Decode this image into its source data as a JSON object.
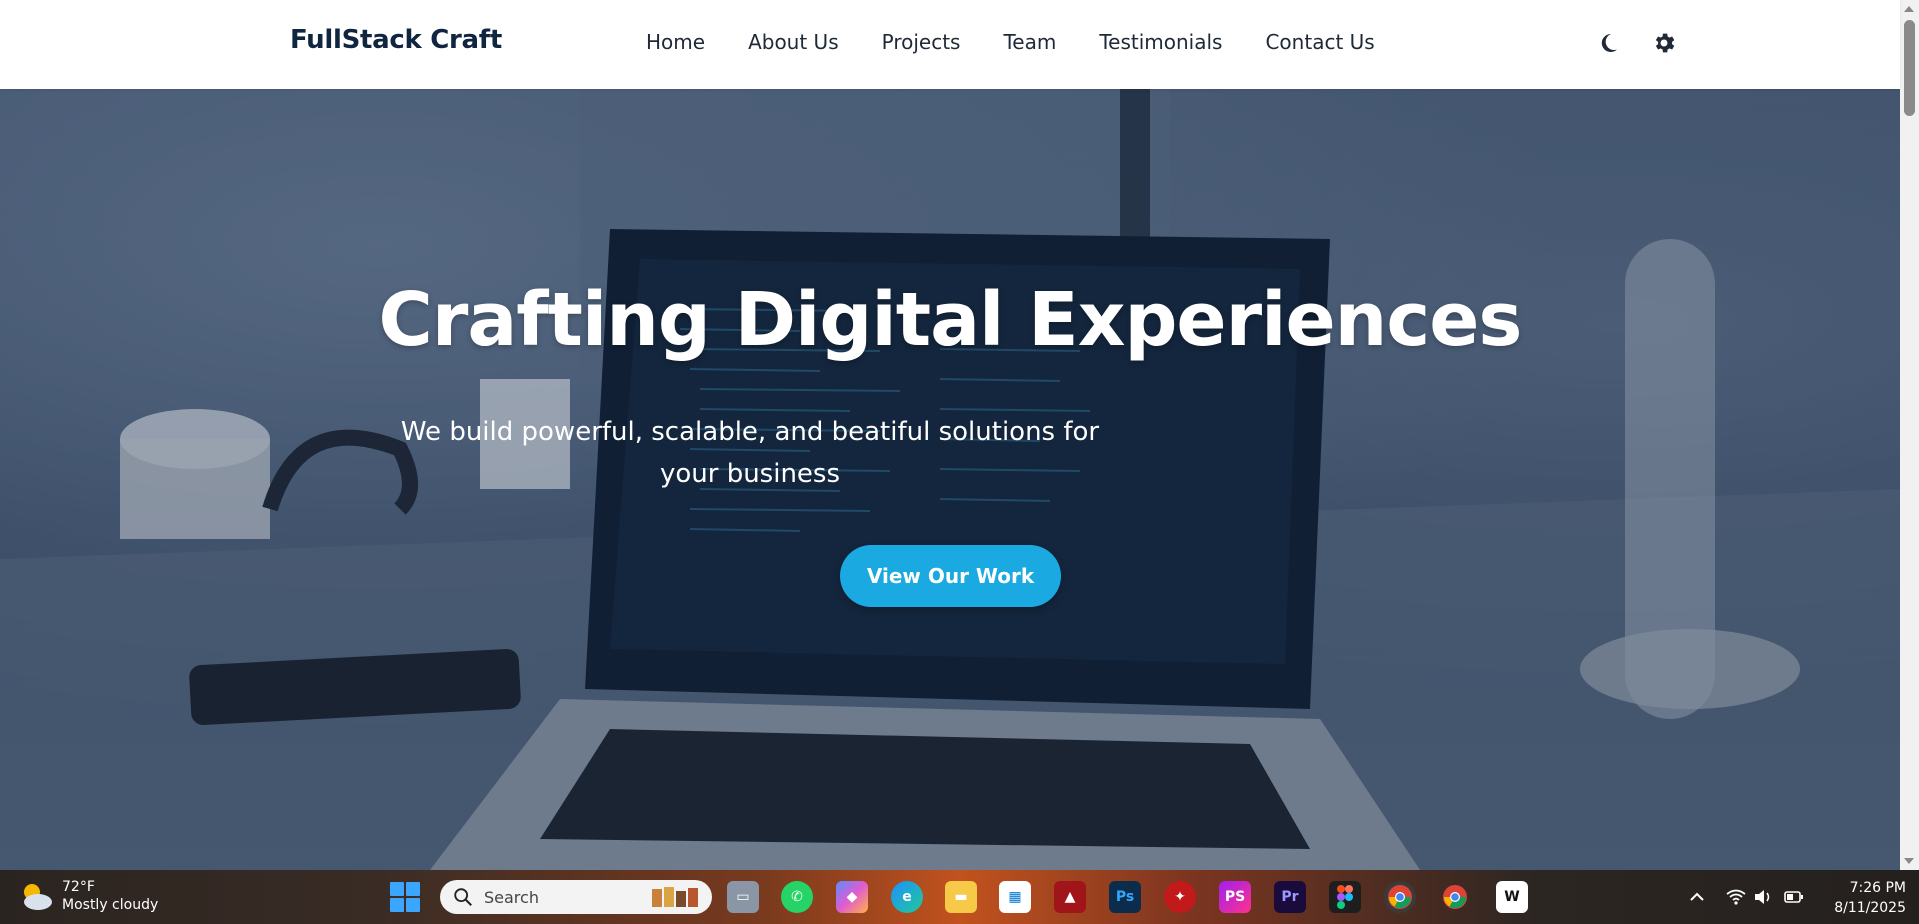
{
  "header": {
    "brand": "FullStack Craft",
    "nav": [
      "Home",
      "About Us",
      "Projects",
      "Team",
      "Testimonials",
      "Contact Us"
    ],
    "icons": [
      "moon-icon",
      "gear-icon"
    ]
  },
  "hero": {
    "title": "Crafting Digital Experiences",
    "subtitle": "We build powerful, scalable, and beatiful solutions for your business",
    "cta_label": "View Our Work",
    "accent_color": "#1aa9e0"
  },
  "taskbar": {
    "weather": {
      "temp": "72°F",
      "condition": "Mostly cloudy"
    },
    "search_placeholder": "Search",
    "apps": [
      "task-view",
      "whatsapp",
      "copilot",
      "edge",
      "file-explorer",
      "microsoft-store",
      "app-red",
      "photoshop",
      "app-antivirus",
      "phpstorm",
      "premiere-pro",
      "figma",
      "chrome-active",
      "chrome",
      "app-w"
    ],
    "clock": {
      "time": "7:26 PM",
      "date": "8/11/2025"
    }
  }
}
